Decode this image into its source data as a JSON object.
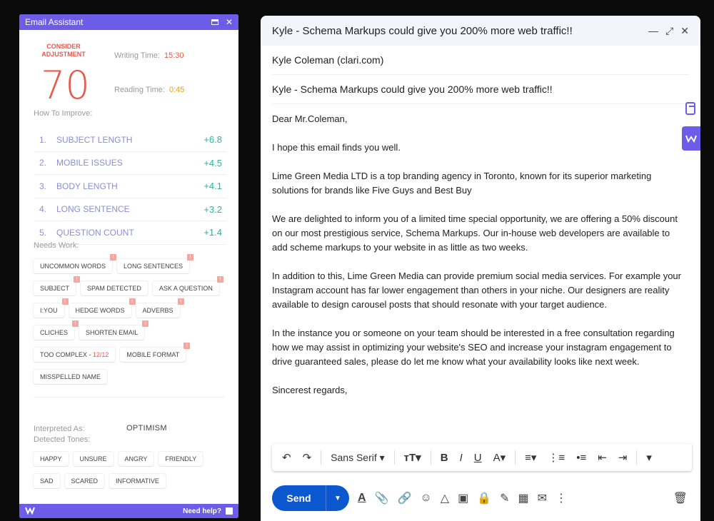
{
  "assistant": {
    "title": "Email Assistant",
    "status": "CONSIDER ADJUSTMENT",
    "score": "70",
    "writing_time_label": "Writing Time:",
    "writing_time_value": "15:30",
    "reading_time_label": "Reading Time:",
    "reading_time_value": "0:45",
    "how_to_improve_label": "How To Improve:",
    "improvements": [
      {
        "num": "1.",
        "label": "SUBJECT LENGTH",
        "value": "+6.8"
      },
      {
        "num": "2.",
        "label": "MOBILE ISSUES",
        "value": "+4.5"
      },
      {
        "num": "3.",
        "label": "BODY LENGTH",
        "value": "+4.1"
      },
      {
        "num": "4.",
        "label": "LONG SENTENCE",
        "value": "+3.2"
      },
      {
        "num": "5.",
        "label": "QUESTION COUNT",
        "value": "+1.4"
      }
    ],
    "needs_work_label": "Needs Work:",
    "needs_work": {
      "c1": "UNCOMMON WORDS",
      "c2": "LONG SENTENCES",
      "c3": "SUBJECT",
      "c4": "SPAM DETECTED",
      "c5": "ASK A QUESTION",
      "c6": "I:YOU",
      "c7": "HEDGE WORDS",
      "c8": "ADVERBS",
      "c9": "CLICHES",
      "c10": "SHORTEN EMAIL",
      "c11_prefix": "TOO COMPLEX - ",
      "c11_value": "12/12",
      "c12": "MOBILE FORMAT",
      "c13": "MISSPELLED NAME",
      "badge": "!"
    },
    "interpreted_label": "Interpreted As:",
    "interpreted_value": "OPTIMISM",
    "detected_tones_label": "Detected Tones:",
    "tones": {
      "t1": "HAPPY",
      "t2": "UNSURE",
      "t3": "ANGRY",
      "t4": "FRIENDLY",
      "t5": "SAD",
      "t6": "SCARED",
      "t7": "INFORMATIVE"
    },
    "need_help": "Need help?"
  },
  "compose": {
    "title": "Kyle - Schema Markups could give you 200% more web traffic!!",
    "to": "Kyle Coleman (clari.com)",
    "subject": "Kyle - Schema Markups could give you 200% more web traffic!!",
    "greeting": "Dear Mr.Coleman,",
    "p1": "I hope this email finds you well.",
    "p2": "Lime Green Media LTD is a top branding agency in Toronto, known for its superior marketing solutions for brands like Five Guys and Best Buy",
    "p3": "We are delighted to inform you of a limited time special opportunity, we are offering a 50% discount on our most prestigious service, Schema Markups. Our in-house web developers are available to add scheme markups to your website in as little as two weeks.",
    "p4": "In addition to this, Lime Green Media can provide premium social media services. For example your Instagram account has far lower engagement than others in your niche. Our designers are reality available to design carousel posts that should resonate with your target audience.",
    "p5": "In the instance you or someone on your team should be interested in a free consultation regarding how we may assist in optimizing your website's SEO and increase your instagram engagement to drive guaranteed sales, please do let me know what your availability looks like next week.",
    "signoff": "Sincerest regards,",
    "font": "Sans Serif",
    "send_label": "Send"
  },
  "colors": {
    "accent": "#6c5ce7",
    "score_red": "#e9584e",
    "reading_orange": "#e8a317",
    "improve_green": "#2bb5a0",
    "send_blue": "#0b57d0"
  }
}
